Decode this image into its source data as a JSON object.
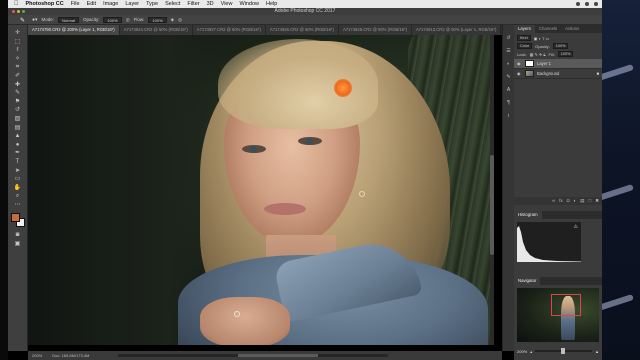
{
  "menubar": {
    "app_name": "Photoshop CC",
    "items": [
      "File",
      "Edit",
      "Image",
      "Layer",
      "Type",
      "Select",
      "Filter",
      "3D",
      "View",
      "Window",
      "Help"
    ]
  },
  "window": {
    "title": "Adobe Photoshop CC 2017"
  },
  "options_bar": {
    "mode_label": "Mode:",
    "mode_value": "Normal",
    "opacity_label": "Opacity:",
    "opacity_value": "100%",
    "flow_label": "Flow:",
    "flow_value": "100%"
  },
  "doc_tabs": [
    {
      "label": "A7174790.CR2 @ 200% (Layer 1, RGB/16*)",
      "active": true
    },
    {
      "label": "A7174924.CR2 @ 50% (RGB/16*)",
      "active": false
    },
    {
      "label": "A7174927.CR2 @ 50% (RGB/16*)",
      "active": false
    },
    {
      "label": "A7174926.CR2 @ 50% (RGB/16*)",
      "active": false
    },
    {
      "label": "A7174928.CR2 @ 50% (RGB/16*)",
      "active": false
    },
    {
      "label": "A7174913.CR2 @ 50% (Layer 1, RGB/16*)",
      "active": false
    }
  ],
  "status": {
    "zoom": "200%",
    "doc": "Doc: 165.8M/173.4M"
  },
  "layers_panel": {
    "tabs": [
      "Layers",
      "Channels",
      "Actions"
    ],
    "kind_label": "Kind",
    "blend_mode": "Color",
    "opacity_label": "Opacity:",
    "opacity_value": "100%",
    "lock_label": "Lock:",
    "fill_label": "Fill:",
    "fill_value": "100%",
    "layers": [
      {
        "name": "Layer 1",
        "selected": true
      },
      {
        "name": "Background",
        "selected": false
      }
    ]
  },
  "histogram_panel": {
    "title": "Histogram"
  },
  "navigator_panel": {
    "title": "Navigator",
    "zoom": "200%",
    "zoom_level": 0.45
  },
  "colors": {
    "foreground": "#c96c3a",
    "background": "#f1f1f1",
    "brush_cursor": "#ee6a1e"
  }
}
